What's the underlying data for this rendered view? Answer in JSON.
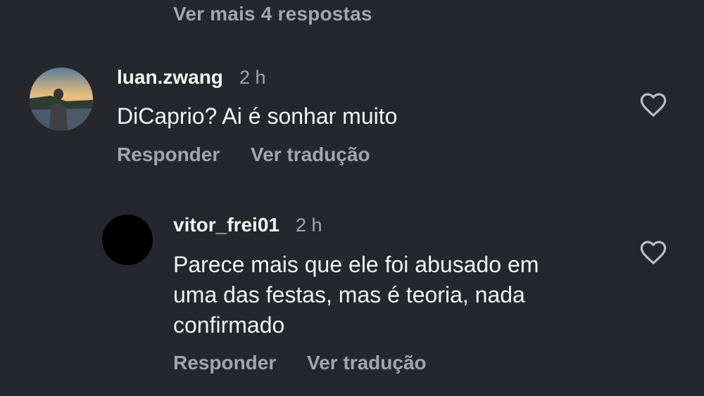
{
  "thread": {
    "more_replies_label": "Ver mais 4 respostas"
  },
  "comments": [
    {
      "username": "luan.zwang",
      "time": "2 h",
      "text_lines": [
        "DiCaprio? Ai é sonhar muito"
      ],
      "reply_label": "Responder",
      "translate_label": "Ver tradução",
      "like_icon": "heart-outline-icon"
    },
    {
      "username": "vitor_frei01",
      "time": "2 h",
      "text_lines": [
        "Parece mais que ele foi abusado em",
        "uma das festas, mas é teoria, nada",
        "confirmado"
      ],
      "reply_label": "Responder",
      "translate_label": "Ver tradução",
      "like_icon": "heart-outline-icon"
    }
  ],
  "colors": {
    "background": "#25272d",
    "primary_text": "#f4f4f4",
    "secondary_text": "#a4a6ab"
  }
}
